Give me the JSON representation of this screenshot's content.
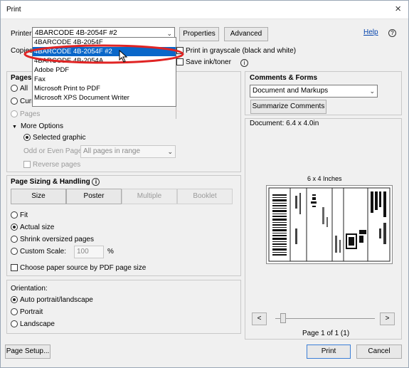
{
  "window": {
    "title": "Print",
    "close": "×"
  },
  "printer": {
    "label": "Printer:",
    "selected": "4BARCODE 4B-2054F #2",
    "properties": "Properties",
    "advanced": "Advanced",
    "help": "Help",
    "options": [
      "4BARCODE 4B-2054F",
      "4BARCODE 4B-2054F #2",
      "4BARCODE 4B-2054A",
      "Adobe PDF",
      "Fax",
      "Microsoft Print to PDF",
      "Microsoft XPS Document Writer"
    ],
    "selected_index": 1
  },
  "copies": {
    "label": "Copies",
    "grayscale": "Print in grayscale (black and white)",
    "save_ink": "Save ink/toner"
  },
  "pages": {
    "heading": "Pages t",
    "all": "All",
    "current": "Curr",
    "pages": "Pages",
    "more_options": "More Options",
    "selected_graphic": "Selected graphic",
    "odd_even_label": "Odd or Even Pages:",
    "odd_even_value": "All pages in range",
    "reverse": "Reverse pages"
  },
  "sizing": {
    "heading": "Page Sizing & Handling",
    "size": "Size",
    "poster": "Poster",
    "multiple": "Multiple",
    "booklet": "Booklet",
    "fit": "Fit",
    "actual": "Actual size",
    "shrink": "Shrink oversized pages",
    "custom": "Custom Scale:",
    "custom_value": "100",
    "percent": "%",
    "paper_source": "Choose paper source by PDF page size"
  },
  "orientation": {
    "heading": "Orientation:",
    "auto": "Auto portrait/landscape",
    "portrait": "Portrait",
    "landscape": "Landscape"
  },
  "comments": {
    "heading": "Comments & Forms",
    "value": "Document and Markups",
    "summarize": "Summarize Comments"
  },
  "preview": {
    "document": "Document: 6.4 x 4.0in",
    "size": "6 x 4 Inches",
    "page": "Page 1 of 1 (1)",
    "prev": "<",
    "next": ">"
  },
  "footer": {
    "page_setup": "Page Setup...",
    "print": "Print",
    "cancel": "Cancel"
  },
  "accent": {
    "highlight_ring": "#e02424",
    "selection": "#0a67c9",
    "link": "#0645ad"
  }
}
